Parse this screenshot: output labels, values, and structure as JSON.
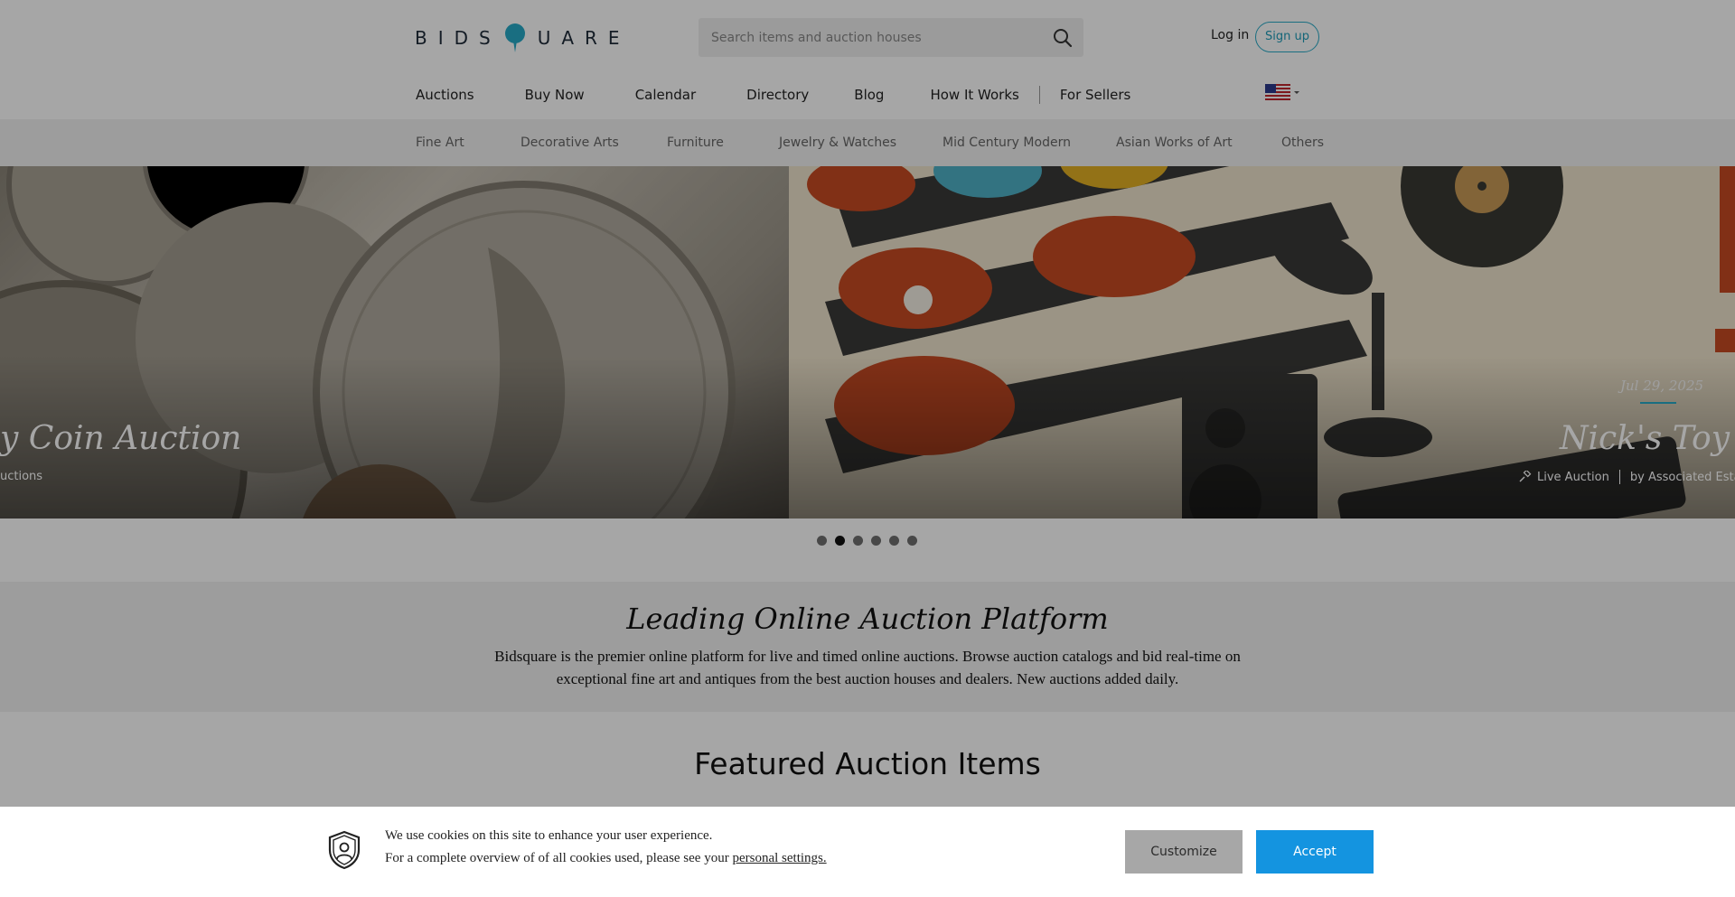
{
  "header": {
    "logo_text_left": "BIDS",
    "logo_text_right": "UARE",
    "search_placeholder": "Search items and auction houses",
    "login_label": "Log in",
    "signup_label": "Sign up"
  },
  "main_nav": {
    "items": [
      "Auctions",
      "Buy Now",
      "Calendar",
      "Directory",
      "Blog",
      "How It Works"
    ],
    "for_sellers": "For Sellers"
  },
  "categories": [
    "Fine Art",
    "Decorative Arts",
    "Furniture",
    "Jewelry & Watches",
    "Mid Century Modern",
    "Asian Works of Art",
    "Others"
  ],
  "hero": {
    "slide_left": {
      "title": "y Coin Auction",
      "meta": "uctions"
    },
    "slide_right": {
      "date": "Jul 29, 2025",
      "title": "Nick's Toy Bo",
      "type": "Live Auction",
      "by": "by Associated Estate I"
    },
    "dots_count": 6,
    "active_dot": 1
  },
  "intro": {
    "heading": "Leading Online Auction Platform",
    "text": "Bidsquare is the premier online platform for live and timed online auctions. Browse auction catalogs and bid real-time on exceptional fine art and antiques from the best auction houses and dealers. New auctions added daily."
  },
  "featured_heading": "Featured Auction Items",
  "cookie": {
    "line1": "We use cookies on this site to enhance your user experience.",
    "line2_prefix": "For a complete overview of of all cookies used, please see your",
    "line2_link": "personal settings.",
    "customize_label": "Customize",
    "accept_label": "Accept"
  },
  "colors": {
    "brand_teal": "#27a9c6",
    "accept_blue": "#1494e0",
    "customize_gray": "#a7a7a7"
  }
}
